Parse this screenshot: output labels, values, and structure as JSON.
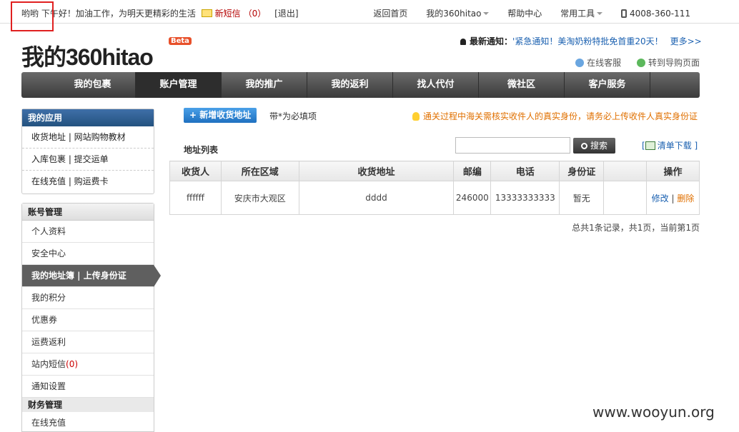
{
  "topbar": {
    "greeting": "哟哟  下午好！加油工作，为明天更精彩的生活",
    "messages_label": "新短信",
    "messages_count": "（0）",
    "logout": "[退出]",
    "links": [
      "返回首页",
      "我的360hitao",
      "帮助中心",
      "常用工具"
    ],
    "phone": "4008-360-111"
  },
  "header": {
    "logo": "我的360hitao",
    "beta": "Beta",
    "notice_label": "最新通知：",
    "notice_text": "'紧急通知！美淘奶粉特批免首重20天！",
    "notice_more": "更多>>",
    "service": "在线客服",
    "guide": "转到导购页面"
  },
  "nav": {
    "tabs": [
      "我的包裹",
      "账户管理",
      "我的推广",
      "我的返利",
      "找人代付",
      "微社区",
      "客户服务"
    ],
    "active": "账户管理"
  },
  "sidebar": {
    "apps_title": "我的应用",
    "apps": [
      "收货地址 | 网站购物教材",
      "入库包裹 | 提交运单",
      "在线充值 | 购运费卡"
    ],
    "account_title": "账号管理",
    "account_items": [
      "个人资料",
      "安全中心",
      "我的地址簿 | 上传身份证",
      "我的积分",
      "优惠券",
      "运费返利",
      "站内短信",
      "通知设置"
    ],
    "sms_count": "(0)",
    "finance_title": "财务管理",
    "finance_items": [
      "在线充值"
    ]
  },
  "content": {
    "add_button": "+ 新增收货地址",
    "required_note": "带*为必填项",
    "tip": "通关过程中海关需核实收件人的真实身份，请务必上传收件人真实身份证",
    "list_title": "地址列表",
    "search_placeholder": "",
    "search_button": "搜索",
    "download": "清单下载",
    "download_brackets": [
      "[",
      "]"
    ],
    "table_headers": [
      "收货人",
      "所在区域",
      "收货地址",
      "邮编",
      "电话",
      "身份证",
      "",
      "操作"
    ],
    "rows": [
      {
        "name": "ffffff",
        "region": "安庆市大观区",
        "address": "dddd",
        "zip": "246000",
        "phone": "13333333333",
        "id": "暂无",
        "extra": "",
        "edit": "修改",
        "sep": "|",
        "delete": "删除"
      }
    ],
    "pager": "总共1条记录，共1页，当前第1页"
  },
  "watermark": "www.wooyun.org"
}
